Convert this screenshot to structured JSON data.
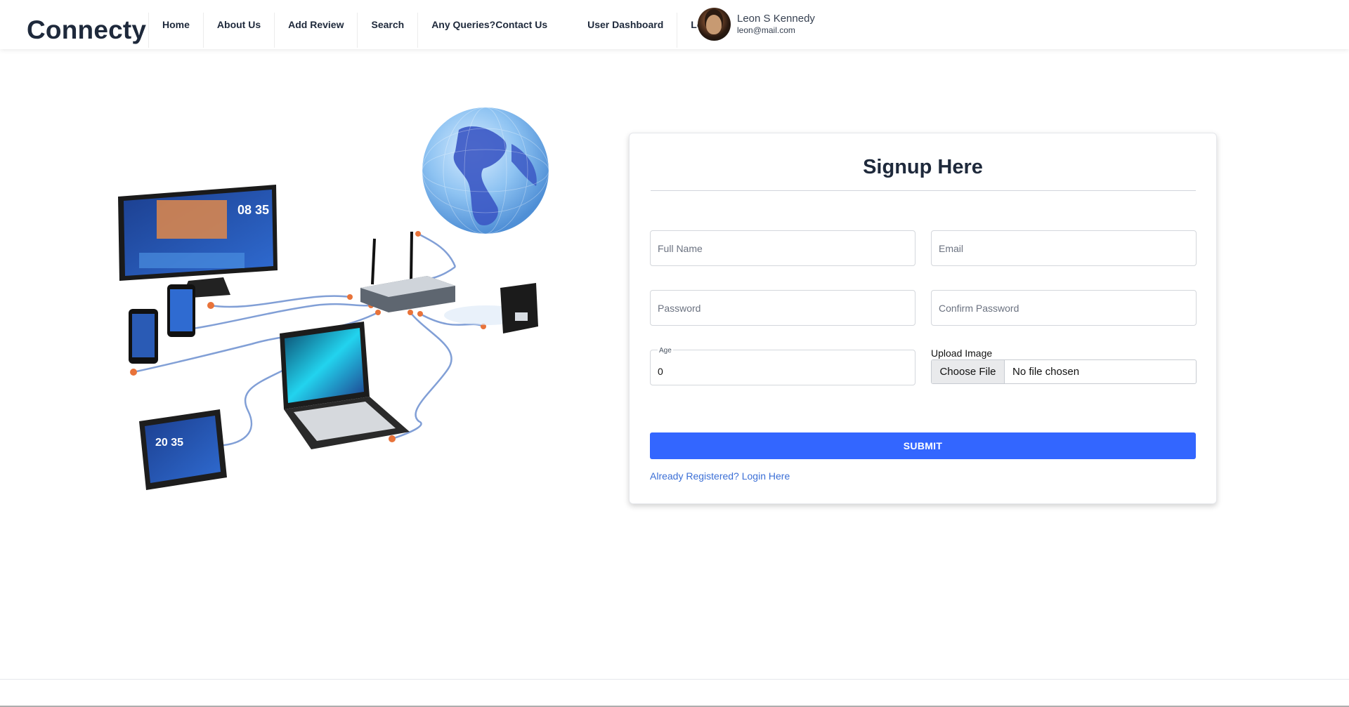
{
  "brand": "Connecty",
  "nav": {
    "items": [
      "Home",
      "About Us",
      "Add Review",
      "Search",
      "Any Queries?",
      "Contact Us",
      "User Dashboard",
      "Logout"
    ]
  },
  "user": {
    "name": "Leon S Kennedy",
    "email": "leon@mail.com"
  },
  "form": {
    "title": "Signup Here",
    "full_name_placeholder": "Full Name",
    "email_placeholder": "Email",
    "password_placeholder": "Password",
    "confirm_password_placeholder": "Confirm Password",
    "age_label": "Age",
    "age_value": "0",
    "upload_label": "Upload Image",
    "choose_file": "Choose File",
    "no_file": "No file chosen",
    "submit": "SUBMIT",
    "login_link": "Already Registered? Login Here"
  },
  "illustration": {
    "tv_time": "08 35",
    "tablet_time": "20 35"
  },
  "colors": {
    "accent": "#3366ff",
    "link": "#3b6fd6",
    "brand_text": "#1e293b"
  }
}
